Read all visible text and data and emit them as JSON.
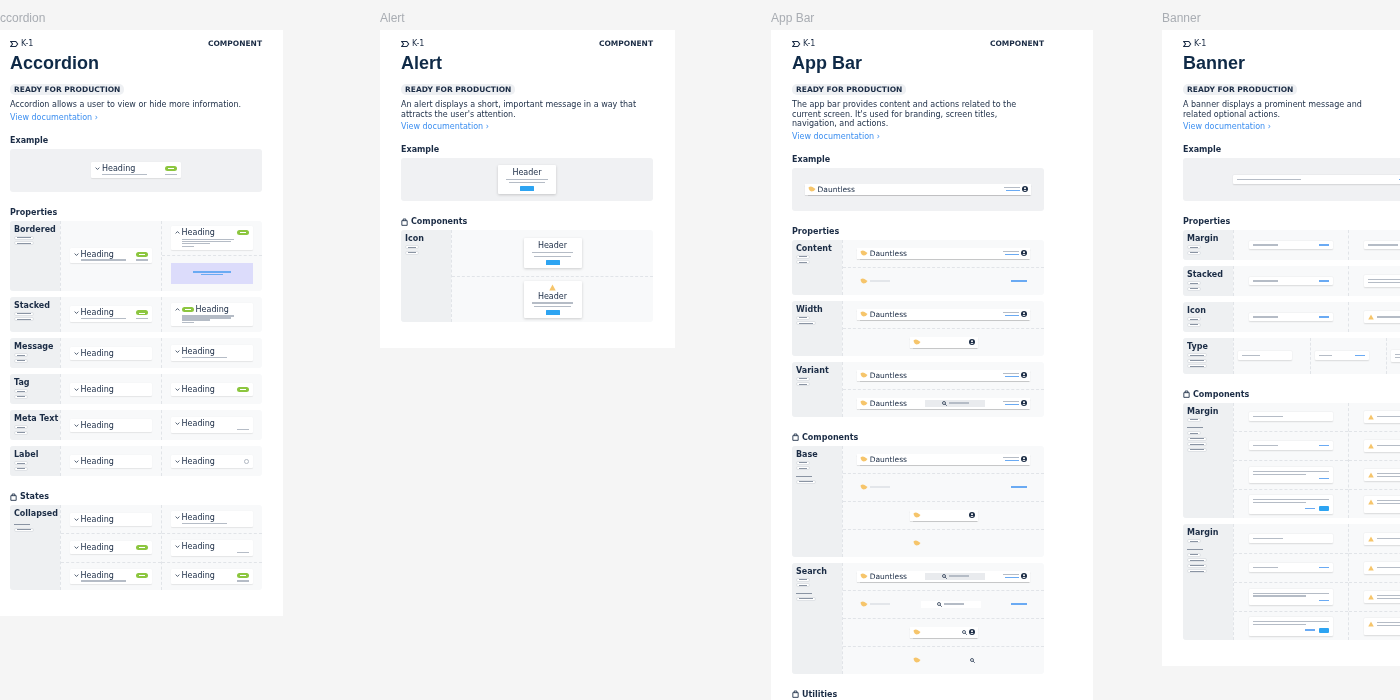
{
  "frames": [
    {
      "label": "ccordion",
      "logo": "K-1",
      "type_badge": "COMPONENT",
      "title": "Accordion",
      "status": "READY FOR PRODUCTION",
      "description": "Accordion allows a user to view or hide more information.",
      "link": "View documentation ›",
      "example_title": "Example",
      "example": [
        {
          "kind": "accordion",
          "heading": "Heading",
          "expanded": false,
          "subtext": true,
          "tag": true,
          "meta": true
        }
      ],
      "sections": [
        {
          "title": "Properties",
          "icon": false,
          "rows": [
            {
              "label": "Bordered",
              "chips": [
                {
                  "kind": "long"
                },
                {
                  "kind": "long"
                }
              ],
              "columns": [
                [
                  {
                    "kind": "accordion",
                    "heading": "Heading",
                    "expanded": false,
                    "subtext": true,
                    "tag": true,
                    "meta": true
                  }
                ],
                [
                  {
                    "kind": "accordion",
                    "heading": "Heading",
                    "expanded": true,
                    "body": true,
                    "tag": true,
                    "meta": true
                  },
                  {
                    "kind": "slot"
                  }
                ]
              ]
            },
            {
              "label": "Stacked",
              "chips": [
                {
                  "kind": "long"
                },
                {
                  "kind": "long"
                }
              ],
              "columns": [
                [
                  {
                    "kind": "accordion",
                    "heading": "Heading",
                    "expanded": false,
                    "subtext": true,
                    "tag": true,
                    "meta": true
                  }
                ],
                [
                  {
                    "kind": "accordion",
                    "heading": "Heading",
                    "expanded": true,
                    "tag_first": true,
                    "tag": true,
                    "body": true,
                    "meta": true
                  }
                ]
              ]
            },
            {
              "label": "Message",
              "chips": [
                {
                  "kind": "short"
                },
                {
                  "kind": "short"
                }
              ],
              "columns": [
                [
                  {
                    "kind": "accordion",
                    "heading": "Heading",
                    "expanded": false
                  }
                ],
                [
                  {
                    "kind": "accordion",
                    "heading": "Heading",
                    "expanded": false,
                    "subtext": true
                  }
                ]
              ]
            },
            {
              "label": "Tag",
              "chips": [
                {
                  "kind": "short"
                },
                {
                  "kind": "short"
                }
              ],
              "columns": [
                [
                  {
                    "kind": "accordion",
                    "heading": "Heading",
                    "expanded": false
                  }
                ],
                [
                  {
                    "kind": "accordion",
                    "heading": "Heading",
                    "expanded": false,
                    "tag": true
                  }
                ]
              ]
            },
            {
              "label": "Meta Text",
              "chips": [
                {
                  "kind": "short"
                },
                {
                  "kind": "short"
                }
              ],
              "columns": [
                [
                  {
                    "kind": "accordion",
                    "heading": "Heading",
                    "expanded": false
                  }
                ],
                [
                  {
                    "kind": "accordion",
                    "heading": "Heading",
                    "expanded": false,
                    "meta": true
                  }
                ]
              ]
            },
            {
              "label": "Label",
              "chips": [
                {
                  "kind": "short"
                },
                {
                  "kind": "short"
                }
              ],
              "columns": [
                [
                  {
                    "kind": "accordion",
                    "heading": "Heading",
                    "expanded": false
                  }
                ],
                [
                  {
                    "kind": "accordion",
                    "heading": "Heading",
                    "expanded": false,
                    "info": true
                  }
                ]
              ]
            }
          ]
        },
        {
          "title": "States",
          "icon": true,
          "rows": [
            {
              "label": "Collapsed",
              "chips": [
                {
                  "kind": "caption"
                },
                {
                  "kind": "long"
                }
              ],
              "columns": [
                [
                  {
                    "kind": "accordion",
                    "heading": "Heading",
                    "expanded": false
                  },
                  {
                    "kind": "accordion",
                    "heading": "Heading",
                    "expanded": false,
                    "tag": true
                  },
                  {
                    "kind": "accordion",
                    "heading": "Heading",
                    "expanded": false,
                    "subtext": true,
                    "tag": true
                  }
                ],
                [
                  {
                    "kind": "accordion",
                    "heading": "Heading",
                    "expanded": false,
                    "subtext": true
                  },
                  {
                    "kind": "accordion",
                    "heading": "Heading",
                    "expanded": false,
                    "meta": true
                  },
                  {
                    "kind": "accordion",
                    "heading": "Heading",
                    "expanded": false,
                    "tag": true,
                    "meta": true
                  }
                ]
              ]
            }
          ]
        }
      ]
    },
    {
      "label": "Alert",
      "logo": "K-1",
      "type_badge": "COMPONENT",
      "title": "Alert",
      "status": "READY FOR PRODUCTION",
      "description": "An alert displays a short, important message in a way that attracts the user's attention.",
      "link": "View documentation ›",
      "example_title": "Example",
      "example": [
        {
          "kind": "alert",
          "heading": "Header",
          "warning": false
        }
      ],
      "sections": [
        {
          "title": "Components",
          "icon": true,
          "rows": [
            {
              "label": "Icon",
              "chips": [
                {
                  "kind": "short"
                },
                {
                  "kind": "short"
                }
              ],
              "columns": [
                [
                  {
                    "kind": "alert",
                    "heading": "Header",
                    "warning": false
                  },
                  {
                    "kind": "alert",
                    "heading": "Header",
                    "warning": true
                  }
                ]
              ]
            }
          ]
        }
      ]
    },
    {
      "label": "App Bar",
      "logo": "K-1",
      "type_badge": "COMPONENT",
      "title": "App Bar",
      "status": "READY FOR PRODUCTION",
      "description": "The app bar provides content and actions related to the current screen. It's used for branding, screen titles, navigation, and actions.",
      "link": "View documentation ›",
      "example_title": "Example",
      "example": [
        {
          "kind": "appbar",
          "brand": "Dauntless",
          "search": false
        }
      ],
      "sections": [
        {
          "title": "Properties",
          "icon": false,
          "rows": [
            {
              "label": "Content",
              "chips": [
                {
                  "kind": "short"
                },
                {
                  "kind": "short"
                }
              ],
              "columns": [
                [
                  {
                    "kind": "appbar",
                    "brand": "Dauntless",
                    "search": false
                  },
                  {
                    "kind": "linkbar",
                    "search": false
                  }
                ]
              ]
            },
            {
              "label": "Width",
              "chips": [
                {
                  "kind": "short"
                },
                {
                  "kind": "long"
                }
              ],
              "columns": [
                [
                  {
                    "kind": "appbar",
                    "brand": "Dauntless",
                    "search": false
                  },
                  {
                    "kind": "compactbar",
                    "search": false
                  }
                ]
              ]
            },
            {
              "label": "Variant",
              "chips": [
                {
                  "kind": "short"
                },
                {
                  "kind": "short"
                }
              ],
              "columns": [
                [
                  {
                    "kind": "appbar",
                    "brand": "Dauntless",
                    "search": false
                  },
                  {
                    "kind": "appbar",
                    "brand": "Dauntless",
                    "search": true
                  }
                ]
              ]
            }
          ]
        },
        {
          "title": "Components",
          "icon": true,
          "rows": [
            {
              "label": "Base",
              "chips": [
                {
                  "kind": "short"
                },
                {
                  "kind": "short"
                },
                {
                  "kind": "caption"
                },
                {
                  "kind": "long"
                }
              ],
              "columns": [
                [
                  {
                    "kind": "appbar",
                    "brand": "Dauntless",
                    "search": false
                  },
                  {
                    "kind": "linkbar",
                    "search": false
                  },
                  {
                    "kind": "compactbar",
                    "search": false
                  },
                  {
                    "kind": "iconbar",
                    "search": false
                  }
                ]
              ]
            },
            {
              "label": "Search",
              "chips": [
                {
                  "kind": "short"
                },
                {
                  "kind": "short"
                },
                {
                  "kind": "caption"
                },
                {
                  "kind": "long"
                }
              ],
              "columns": [
                [
                  {
                    "kind": "appbar",
                    "brand": "Dauntless",
                    "search": true
                  },
                  {
                    "kind": "linkbar",
                    "search": true
                  },
                  {
                    "kind": "compactbar",
                    "search": true
                  },
                  {
                    "kind": "iconbar",
                    "search": true
                  }
                ]
              ]
            }
          ]
        },
        {
          "title": "Utilities",
          "icon": true
        }
      ]
    },
    {
      "label": "Banner",
      "logo": "K-1",
      "title": "Banner",
      "status": "READY FOR PRODUCTION",
      "description": "A banner displays a prominent message and related optional actions.",
      "link": "View documentation ›",
      "example_title": "Example",
      "example": [
        {
          "kind": "banner",
          "action": true
        }
      ],
      "sections": [
        {
          "title": "Properties",
          "icon": false,
          "rows": [
            {
              "label": "Margin",
              "chips": [
                {
                  "kind": "short"
                },
                {
                  "kind": "short"
                }
              ],
              "columns": [
                [
                  {
                    "kind": "banner",
                    "action": true
                  }
                ],
                [
                  {
                    "kind": "banner"
                  }
                ]
              ]
            },
            {
              "label": "Stacked",
              "chips": [
                {
                  "kind": "short"
                },
                {
                  "kind": "short"
                }
              ],
              "columns": [
                [
                  {
                    "kind": "banner",
                    "action": true
                  }
                ],
                [
                  {
                    "kind": "banner",
                    "long": true
                  }
                ]
              ]
            },
            {
              "label": "Icon",
              "chips": [
                {
                  "kind": "short"
                },
                {
                  "kind": "short"
                }
              ],
              "columns": [
                [
                  {
                    "kind": "banner",
                    "action": true
                  }
                ],
                [
                  {
                    "kind": "banner",
                    "warning": true
                  }
                ]
              ]
            },
            {
              "label": "Type",
              "chips": [
                {
                  "kind": "long"
                },
                {
                  "kind": "long"
                },
                {
                  "kind": "long"
                }
              ],
              "columns": [
                [
                  {
                    "kind": "banner"
                  }
                ],
                [
                  {
                    "kind": "banner",
                    "action": true
                  }
                ],
                [
                  {
                    "kind": "banner",
                    "long": true
                  }
                ]
              ]
            }
          ]
        },
        {
          "title": "Components",
          "icon": true,
          "rows": [
            {
              "label": "Margin",
              "chips": [
                {
                  "kind": "short"
                },
                {
                  "kind": "caption"
                },
                {
                  "kind": "short"
                },
                {
                  "kind": "long"
                },
                {
                  "kind": "long"
                },
                {
                  "kind": "long"
                }
              ],
              "columns": [
                [
                  {
                    "kind": "banner"
                  },
                  {
                    "kind": "banner",
                    "action": true
                  },
                  {
                    "kind": "banner",
                    "long": true,
                    "stacked": true,
                    "action": true
                  },
                  {
                    "kind": "banner",
                    "long": true,
                    "stacked": true,
                    "action": true,
                    "button": true
                  }
                ],
                [
                  {
                    "kind": "banner",
                    "warning": true
                  },
                  {
                    "kind": "banner",
                    "warning": true
                  },
                  {
                    "kind": "banner",
                    "warning": true,
                    "long": true
                  },
                  {
                    "kind": "banner",
                    "warning": true,
                    "long": true,
                    "stacked": true,
                    "action": true
                  }
                ]
              ]
            },
            {
              "label": "Margin",
              "chips": [
                {
                  "kind": "short"
                },
                {
                  "kind": "caption"
                },
                {
                  "kind": "short"
                },
                {
                  "kind": "long"
                },
                {
                  "kind": "long"
                },
                {
                  "kind": "long"
                }
              ],
              "columns": [
                [
                  {
                    "kind": "banner"
                  },
                  {
                    "kind": "banner",
                    "action": true
                  },
                  {
                    "kind": "banner",
                    "long": true,
                    "stacked": true,
                    "action": true
                  },
                  {
                    "kind": "banner",
                    "long": true,
                    "stacked": true,
                    "action": true,
                    "button": true
                  }
                ],
                [
                  {
                    "kind": "banner",
                    "warning": true
                  },
                  {
                    "kind": "banner",
                    "warning": true
                  },
                  {
                    "kind": "banner",
                    "warning": true,
                    "long": true
                  },
                  {
                    "kind": "banner",
                    "warning": true,
                    "long": true,
                    "stacked": true,
                    "action": true
                  }
                ]
              ]
            }
          ]
        }
      ]
    }
  ]
}
